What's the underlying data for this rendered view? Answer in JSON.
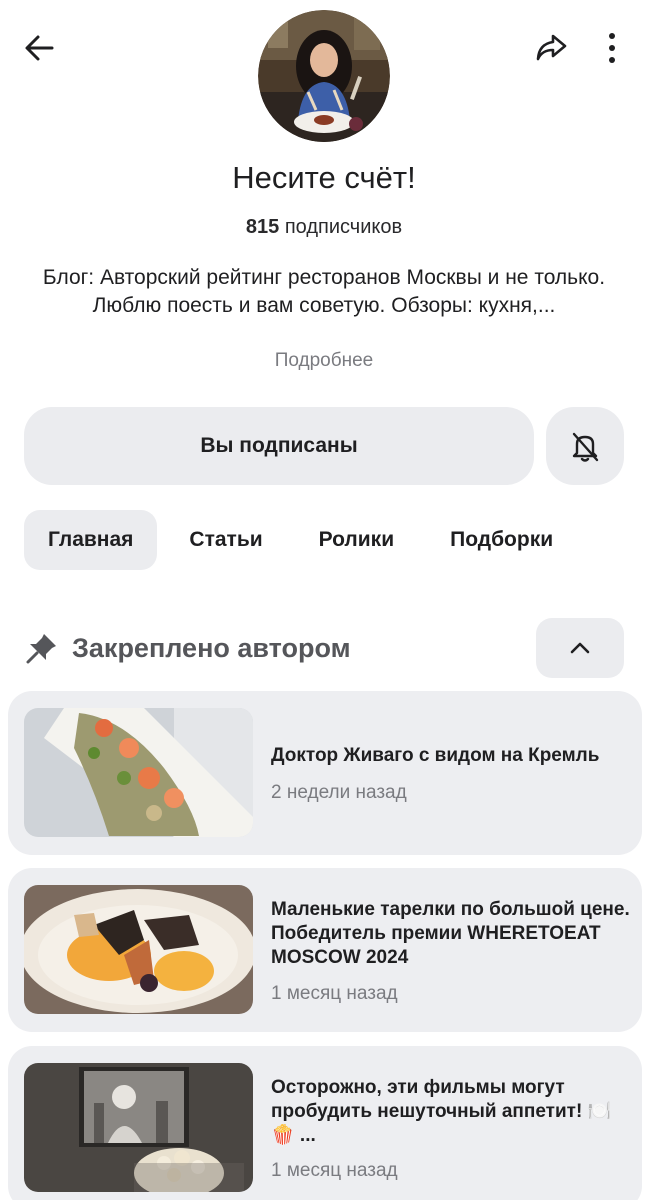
{
  "header": {
    "back_icon": "arrow-left-icon",
    "share_icon": "share-arrow-icon",
    "more_icon": "vertical-dots-icon",
    "avatar": "channel-avatar"
  },
  "channel": {
    "name": "Несите счёт!",
    "subscribers_count": "815",
    "subscribers_label": " подписчиков",
    "description": "Блог: Авторский рейтинг ресторанов Москвы и не только. Люблю поесть и вам советую. Обзоры: кухня,...",
    "more_link": "Подробнее"
  },
  "actions": {
    "subscribed_label": "Вы подписаны",
    "bell_icon": "bell-off-icon"
  },
  "tabs": [
    {
      "label": "Главная",
      "active": true
    },
    {
      "label": "Статьи",
      "active": false
    },
    {
      "label": "Ролики",
      "active": false
    },
    {
      "label": "Подборки",
      "active": false
    }
  ],
  "pinned": {
    "label": "Закреплено автором",
    "pin_icon": "pin-icon",
    "collapse_icon": "chevron-up-icon"
  },
  "articles": [
    {
      "title": "Доктор Живаго с видом на Кремль",
      "time": "2 недели назад"
    },
    {
      "title": "Маленькие тарелки по большой цене. Победитель премии WHERETOEAT MOSCOW 2024",
      "time": "1 месяц назад"
    },
    {
      "title": "Осторожно, эти фильмы могут пробудить нешуточный аппетит! 🍽️🍿 ...",
      "time": "1 месяц назад"
    }
  ],
  "colors": {
    "button_bg": "#ebecef",
    "card_bg": "#edeef1",
    "muted_text": "#7a7b80",
    "text": "#1f1f21"
  }
}
